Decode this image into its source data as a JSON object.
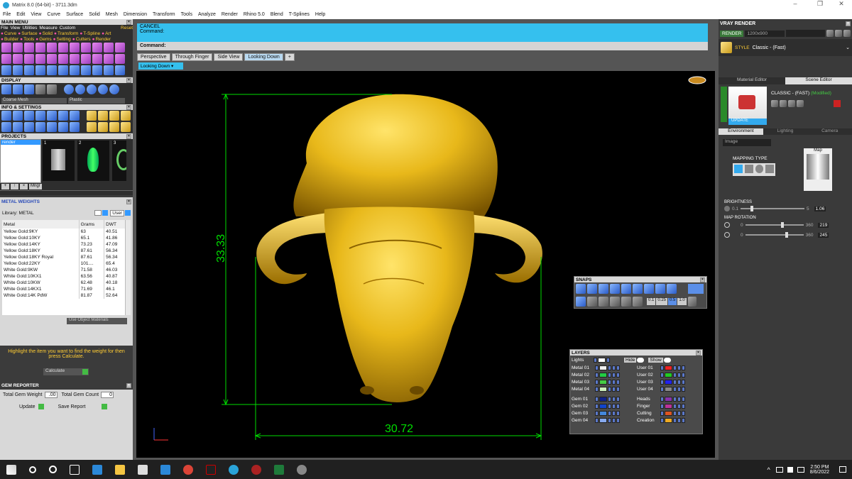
{
  "window": {
    "title": "Matrix 8.0 (64-bit) - 3711.3dm"
  },
  "menu": [
    "File",
    "Edit",
    "View",
    "Curve",
    "Surface",
    "Solid",
    "Mesh",
    "Dimension",
    "Transform",
    "Tools",
    "Analyze",
    "Render",
    "Rhino 5.0",
    "Blend",
    "T-Splines",
    "Help"
  ],
  "main_menu": {
    "title": "MAIN MENU",
    "row1": [
      "File",
      "View",
      "Utilities",
      "Measure",
      "Custom"
    ],
    "reset": "Reset",
    "row2": [
      "Curve",
      "Surface",
      "Solid",
      "Transform",
      "T-Spline",
      "Art"
    ],
    "row3": [
      "Builder",
      "Tools",
      "Gems",
      "Setting",
      "Cutters",
      "Render"
    ]
  },
  "display": {
    "title": "DISPLAY",
    "mesh": "Coarse Mesh",
    "material": "Plastic"
  },
  "info": {
    "title": "INFO & SETTINGS"
  },
  "projects": {
    "title": "PROJECTS",
    "item": "render",
    "thumbs": [
      "1",
      "2",
      "3"
    ],
    "mngr": "Mngr"
  },
  "metal_weights": {
    "title": "METAL WEIGHTS",
    "library_label": "Library: METAL",
    "user_label": "User",
    "headers": [
      "Metal",
      "Grams",
      "DWT"
    ],
    "rows": [
      [
        "Yellow Gold:9KY",
        "63",
        "40.51"
      ],
      [
        "Yellow Gold:10KY",
        "65.1",
        "41.86"
      ],
      [
        "Yellow Gold:14KY",
        "73.23",
        "47.09"
      ],
      [
        "Yellow Gold:18KY",
        "87.61",
        "56.34"
      ],
      [
        "Yellow Gold:18KY Royal",
        "87.61",
        "56.34"
      ],
      [
        "Yellow Gold:22KY",
        "101....",
        "65.4"
      ],
      [
        "White Gold:9KW",
        "71.58",
        "46.03"
      ],
      [
        "White Gold:10KX1",
        "63.56",
        "40.87"
      ],
      [
        "White Gold:10KW",
        "62.48",
        "40.18"
      ],
      [
        "White Gold:14KX1",
        "71.69",
        "46.1"
      ],
      [
        "White Gold:14K PdW",
        "81.87",
        "52.64"
      ]
    ],
    "use_object": "Use Object Materials",
    "hint": "Highlight the item you want to find the weight for then press Calculate.",
    "calc": "Calculate"
  },
  "gem_reporter": {
    "title": "GEM REPORTER",
    "total_weight_label": "Total Gem Weight",
    "total_weight": ".00",
    "total_count_label": "Total Gem Count",
    "total_count": "0",
    "update": "Update",
    "save": "Save Report"
  },
  "command": {
    "cancel": "CANCEL",
    "prompt": "Command:",
    "line": "Command:"
  },
  "tabs": [
    "Perspective",
    "Through Finger",
    "Side View",
    "Looking Down"
  ],
  "viewport_name": "Looking Down",
  "dims": {
    "height": "33.33",
    "width": "30.72"
  },
  "snaps": {
    "title": "SNAPS",
    "vals": [
      "0.1",
      "0.25",
      "0.5",
      "1.0"
    ]
  },
  "layers": {
    "title": "LAYERS",
    "lights": "Lights",
    "hide": "Hide",
    "show": "Show",
    "left": [
      [
        "Metal 01",
        "#eeeeee"
      ],
      [
        "Metal 02",
        "#22cc44"
      ],
      [
        "Metal 03",
        "#44cc44"
      ],
      [
        "Metal 04",
        "#cceebb"
      ],
      [
        "Gem 01",
        "#112288"
      ],
      [
        "Gem 02",
        "#1144cc"
      ],
      [
        "Gem 03",
        "#4488dd"
      ],
      [
        "Gem 04",
        "#88aaee"
      ]
    ],
    "right": [
      [
        "User 01",
        "#ee2222"
      ],
      [
        "User 02",
        "#22cc22"
      ],
      [
        "User 03",
        "#2222ee"
      ],
      [
        "User 04",
        "#888888"
      ],
      [
        "Heads",
        "#8833aa"
      ],
      [
        "Finger",
        "#bb3399"
      ],
      [
        "Cutting",
        "#dd5522"
      ],
      [
        "Creation",
        "#eeaa22"
      ]
    ]
  },
  "vray": {
    "title": "VRAY RENDER",
    "render": "RENDER",
    "size": "1200x900",
    "style_label": "STYLE",
    "style": "Classic - (Fast)",
    "tabs": [
      "Material Editor",
      "Scene Editor"
    ],
    "preset": "CLASSIC - (FAST)",
    "modified": "(Modified)",
    "update": "UPDATE",
    "env_tabs": [
      "Environment",
      "Lighting",
      "Camera"
    ],
    "image": "Image",
    "mapping": "MAPPING TYPE",
    "map": "Map",
    "brightness": "BRIGHTNESS",
    "b_min": "0.1",
    "b_max": "5",
    "b_val": "1.06",
    "map_rotation": "MAP ROTATION",
    "r1_min": "0",
    "r1_max": "360",
    "r1_val": "219",
    "r2_min": "0",
    "r2_max": "360",
    "r2_val": "245"
  },
  "clock": {
    "time": "2:50 PM",
    "date": "8/6/2022"
  }
}
